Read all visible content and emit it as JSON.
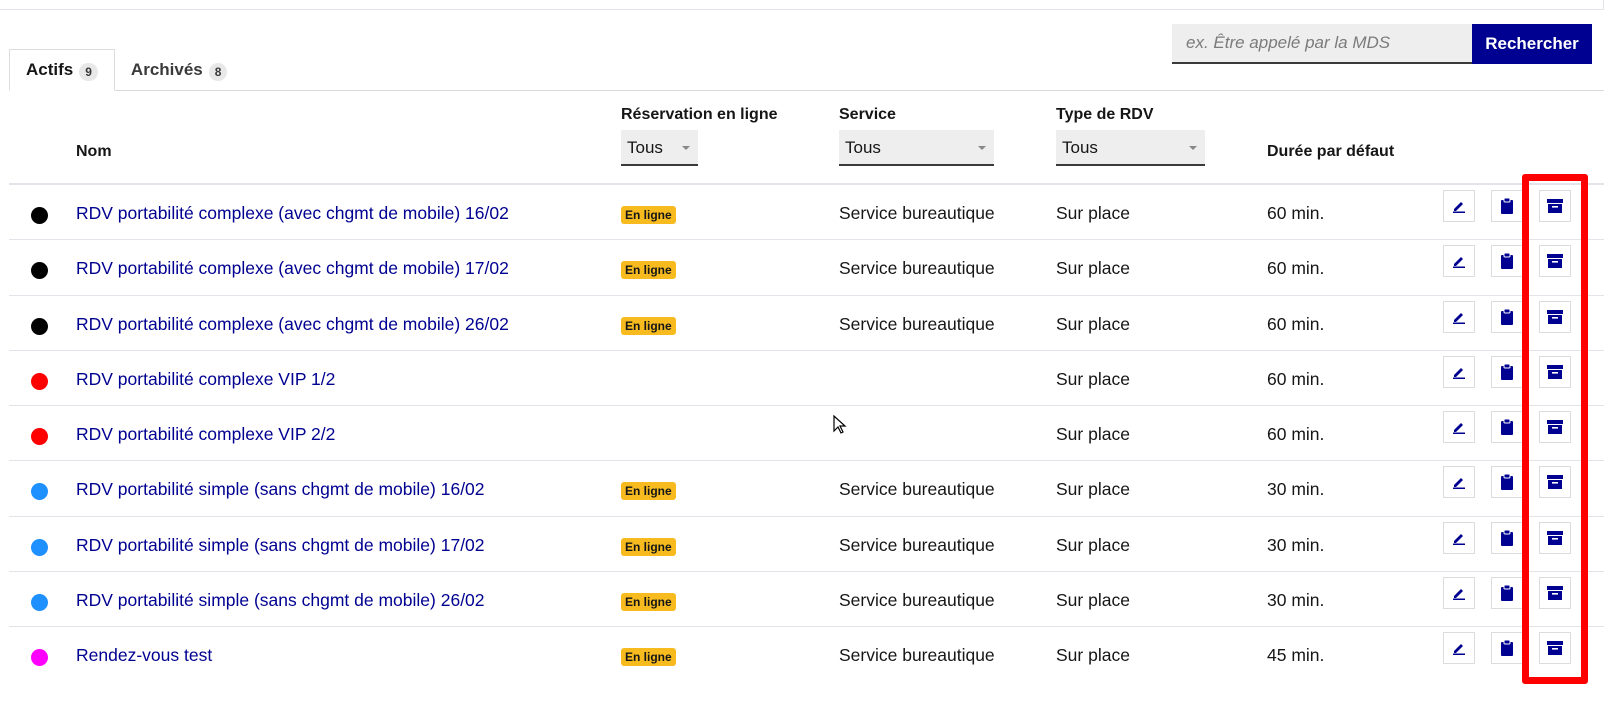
{
  "search": {
    "placeholder": "ex. Être appelé par la MDS",
    "button_label": "Rechercher"
  },
  "tabs": [
    {
      "label": "Actifs",
      "count": "9",
      "active": true
    },
    {
      "label": "Archivés",
      "count": "8",
      "active": false
    }
  ],
  "table": {
    "headers": {
      "name": "Nom",
      "online": "Réservation en ligne",
      "service": "Service",
      "type": "Type de RDV",
      "duration": "Durée par défaut"
    },
    "filters": {
      "online": "Tous",
      "service": "Tous",
      "type": "Tous"
    },
    "rows": [
      {
        "color": "#000000",
        "name": "RDV portabilité complexe (avec chgmt de mobile) 16/02",
        "online": "En ligne",
        "service": "Service bureautique",
        "type": "Sur place",
        "duration": "60 min."
      },
      {
        "color": "#000000",
        "name": "RDV portabilité complexe (avec chgmt de mobile) 17/02",
        "online": "En ligne",
        "service": "Service bureautique",
        "type": "Sur place",
        "duration": "60 min."
      },
      {
        "color": "#000000",
        "name": "RDV portabilité complexe (avec chgmt de mobile) 26/02",
        "online": "En ligne",
        "service": "Service bureautique",
        "type": "Sur place",
        "duration": "60 min."
      },
      {
        "color": "#ff0000",
        "name": "RDV portabilité complexe VIP 1/2",
        "online": "",
        "service": "",
        "type": "Sur place",
        "duration": "60 min."
      },
      {
        "color": "#ff0000",
        "name": "RDV portabilité complexe VIP 2/2",
        "online": "",
        "service": "",
        "type": "Sur place",
        "duration": "60 min."
      },
      {
        "color": "#1e90ff",
        "name": "RDV portabilité simple (sans chgmt de mobile) 16/02",
        "online": "En ligne",
        "service": "Service bureautique",
        "type": "Sur place",
        "duration": "30 min."
      },
      {
        "color": "#1e90ff",
        "name": "RDV portabilité simple (sans chgmt de mobile) 17/02",
        "online": "En ligne",
        "service": "Service bureautique",
        "type": "Sur place",
        "duration": "30 min."
      },
      {
        "color": "#1e90ff",
        "name": "RDV portabilité simple (sans chgmt de mobile) 26/02",
        "online": "En ligne",
        "service": "Service bureautique",
        "type": "Sur place",
        "duration": "30 min."
      },
      {
        "color": "#ff00ff",
        "name": "Rendez-vous test",
        "online": "En ligne",
        "service": "Service bureautique",
        "type": "Sur place",
        "duration": "45 min."
      }
    ]
  },
  "icons": {
    "edit": "pencil-icon",
    "duplicate": "clipboard-icon",
    "archive": "archive-box-icon"
  },
  "colors": {
    "primary": "#000091",
    "badge": "#f7bb1f",
    "highlight": "#ff0000"
  }
}
